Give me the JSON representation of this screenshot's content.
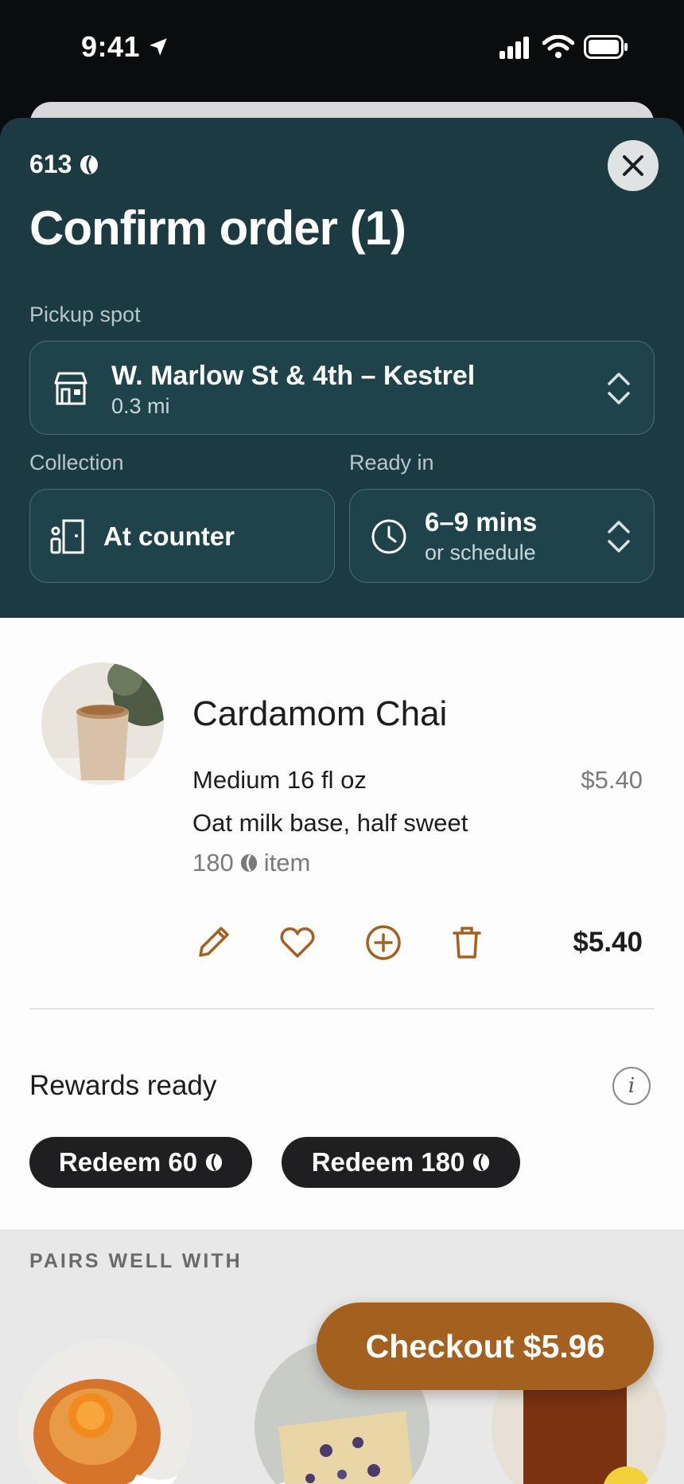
{
  "status_bar": {
    "time": "9:41"
  },
  "header": {
    "points": "613",
    "title": "Confirm order (1)"
  },
  "pickup": {
    "label": "Pickup spot",
    "name": "W. Marlow St & 4th – Kestrel",
    "distance": "0.3 mi"
  },
  "collection": {
    "label": "Collection",
    "value": "At counter"
  },
  "ready": {
    "label": "Ready in",
    "time": "6–9 mins",
    "sub": "or schedule"
  },
  "item": {
    "name": "Cardamom Chai",
    "size": "Medium 16 fl oz",
    "size_price": "$5.40",
    "customization": "Oat milk base, half sweet",
    "points": "180",
    "points_suffix": "item",
    "total": "$5.40"
  },
  "rewards": {
    "title": "Rewards ready",
    "info": "i",
    "options": [
      {
        "label": "Redeem 60"
      },
      {
        "label": "Redeem 180"
      }
    ]
  },
  "pairs": {
    "label": "PAIRS WELL WITH"
  },
  "checkout": {
    "label": "Checkout $5.96"
  },
  "colors": {
    "header_bg": "#1b3a42",
    "accent": "#a4601f",
    "pill_bg": "#1f1f21"
  }
}
